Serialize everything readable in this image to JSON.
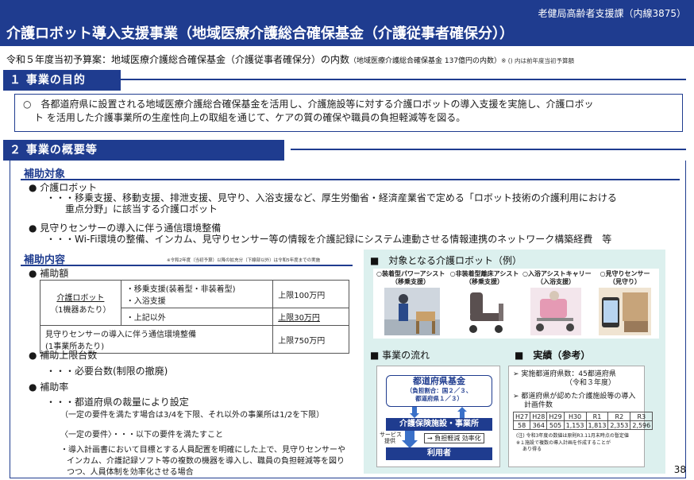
{
  "header": {
    "department": "老健局高齢者支援課（内線3875）",
    "title": "介護ロボット導入支援事業（地域医療介護総合確保基金（介護従事者確保分））"
  },
  "budget": {
    "main": "令和５年度当初予算案：地域医療介護総合確保基金（介護従事者確保分）の内数",
    "paren": "（地域医療介護総合確保基金 137億円の内数）",
    "note": "※ () 内は前年度当初予算額"
  },
  "section1": {
    "title": "１ 事業の目的",
    "line1": "○　各都道府県に設置される地域医療介護総合確保基金を活用し、介護施設等に対する介護ロボットの導入支援を実施し、介護ロボッ",
    "line2": "ト を活用した介護事業所の生産性向上の取組を通じて、ケアの質の確保や職員の負担軽減等を図る。"
  },
  "section2": {
    "title": "２ 事業の概要等",
    "target": {
      "heading": "補助対象",
      "item1_title": "介護ロボット",
      "item1_desc_line1": "・・・移乗支援、移動支援、排泄支援、見守り、入浴支援など、厚生労働省・経済産業省で定める「ロボット技術の介護利用における",
      "item1_desc_line2": "重点分野」に該当する介護ロボット",
      "item2_title": "見守りセンサーの導入に伴う通信環境整備",
      "item2_desc": "・・・Wi-Fi環境の整備、インカム、見守りセンサー等の情報を介護記録にシステム連動させる情報連携のネットワーク構築経費　等"
    },
    "content": {
      "heading": "補助内容",
      "note": "※令和2年度（当初予算）以降の拡充分（下線部以外）は令和5年度までの実施",
      "subsidy_amount": "補助額",
      "table": {
        "robot_label": "介護ロボット",
        "robot_unit": "（1機器あたり）",
        "row1_items": "・移乗支援(装着型・非装着型)",
        "row1_items2": "・入浴支援",
        "row1_limit": "上限100万円",
        "row2_items": "・上記以外",
        "row2_limit": "上限30万円",
        "row3_label": "見守りセンサーの導入に伴う通信環境整備",
        "row3_unit": "(1事業所あたり)",
        "row3_limit": "上限750万円"
      },
      "max_units": "補助上限台数",
      "max_units_desc": "・・・必要台数(制限の撤廃)",
      "rate": "補助率",
      "rate_desc": "・・・都道府県の裁量により設定",
      "rate_note": "（一定の要件を満たす場合は3/4を下限、それ以外の事業所は1/2を下限）",
      "req_title": "〈一定の要件〉・・・以下の要件を満たすこと",
      "req_line1": "・導入計画書において目標とする人員配置を明確にした上で、見守りセンサーや",
      "req_line2": "インカム、介護記録ソフト等の複数の機器を導入し、職員の負担軽減等を図り",
      "req_line3": "つつ、人員体制を効率化させる場合"
    }
  },
  "panel": {
    "robots_heading": "■　対象となる介護ロボット（例）",
    "robots": [
      {
        "label1": "○装着型パワーアシスト",
        "label2": "（移乗支援）"
      },
      {
        "label1": "○非装着型離床アシスト",
        "label2": "（移乗支援）"
      },
      {
        "label1": "○入浴アシストキャリー",
        "label2": "（入浴支援）"
      },
      {
        "label1": "○見守りセンサー",
        "label2": "（見守り）"
      }
    ],
    "flow_heading": "■ 事業の流れ",
    "flow": {
      "fund": "都道府県基金",
      "fund_sub1": "（負担割合：国２／３、",
      "fund_sub2": "都道府県１／３）",
      "facility": "介護保険施設・事業所",
      "service_label1": "サービス",
      "service_label2": "提供",
      "effect": "負担軽減 効率化",
      "user": "利用者"
    },
    "record_heading": "■　実績（参考）",
    "record": {
      "line1": "実施都道府県数：45都道府県",
      "line1b": "（令和３年度）",
      "line2": "都道府県が認めた介護施設等の導入",
      "line2b": "計画件数",
      "years": [
        "H27",
        "H28",
        "H29",
        "H30",
        "R1",
        "R2",
        "R3"
      ],
      "counts": [
        "58",
        "364",
        "505",
        "1,153",
        "1,813",
        "2,353",
        "2,596"
      ],
      "note1": "(注) 令和3年度の数値は原則R3.11月末時点の暫定値",
      "note2": "※１施設で複数の導入計画を作成することが",
      "note3": "あり得る"
    }
  },
  "page_number": "38",
  "colors": {
    "brand": "#1f3c8f",
    "panel_bg": "#dcf0ee"
  }
}
